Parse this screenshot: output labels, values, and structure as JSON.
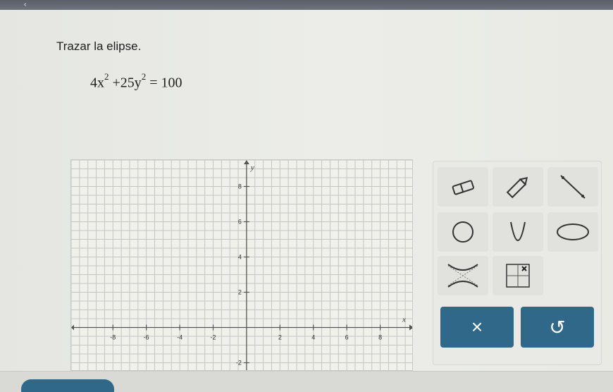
{
  "header": {
    "back_icon": "chevron-left-icon"
  },
  "question": {
    "prompt": "Trazar la elipse.",
    "equation": {
      "t1": "4x",
      "e1": "2",
      "op": "+",
      "t2": "25y",
      "e2": "2",
      "rhs": "= 100"
    }
  },
  "chart_data": {
    "type": "scatter",
    "xlabel": "x",
    "ylabel": "y",
    "xlim": [
      -10.5,
      10
    ],
    "ylim": [
      -2.5,
      9.5
    ],
    "grid": true,
    "x_ticks": [
      -8,
      -6,
      -4,
      -2,
      2,
      4,
      6,
      8
    ],
    "y_ticks": [
      -2,
      2,
      4,
      6,
      8
    ],
    "series": []
  },
  "tools": [
    {
      "icon": "eraser-icon"
    },
    {
      "icon": "pencil-icon"
    },
    {
      "icon": "line-segment-icon"
    },
    {
      "icon": "circle-icon"
    },
    {
      "icon": "parabola-icon"
    },
    {
      "icon": "ellipse-icon"
    },
    {
      "icon": "hyperbola-icon"
    },
    {
      "icon": "point-grid-icon"
    }
  ],
  "actions": {
    "clear_label": "×",
    "undo_label": "↺"
  },
  "colors": {
    "accent": "#2f6888",
    "grid": "#c4c5bf",
    "axis": "#555555"
  }
}
